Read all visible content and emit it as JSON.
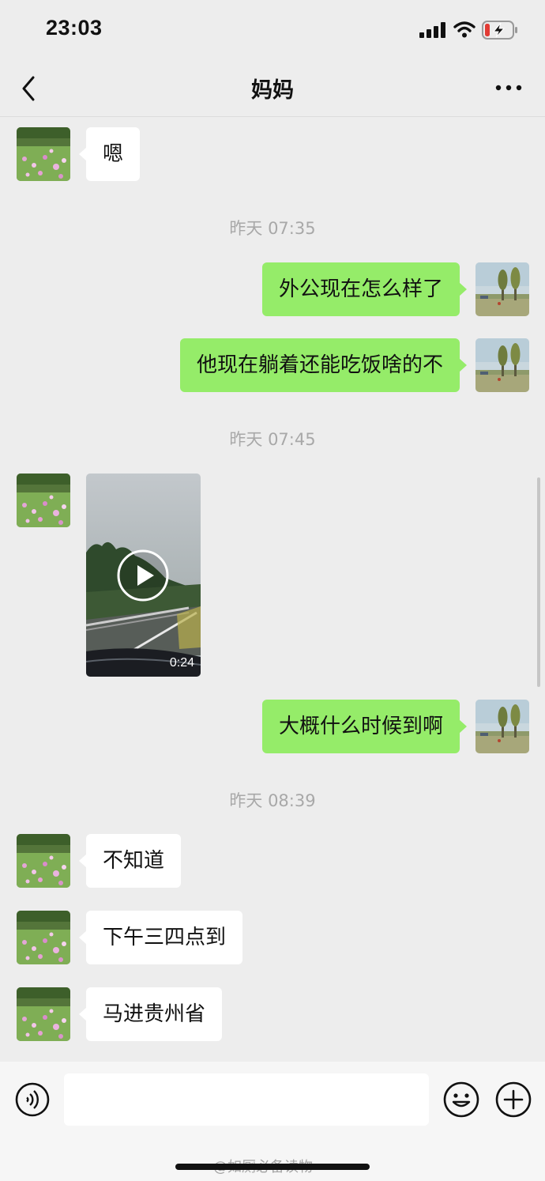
{
  "status_bar": {
    "time": "23:03"
  },
  "nav": {
    "title": "妈妈"
  },
  "messages": [
    {
      "side": "in",
      "text": "嗯"
    },
    {
      "timestamp": "昨天 07:35"
    },
    {
      "side": "out",
      "text": "外公现在怎么样了"
    },
    {
      "side": "out",
      "text": "他现在躺着还能吃饭啥的不"
    },
    {
      "timestamp": "昨天 07:45"
    },
    {
      "side": "in",
      "type": "video",
      "duration": "0:24"
    },
    {
      "side": "out",
      "text": "大概什么时候到啊"
    },
    {
      "timestamp": "昨天 08:39"
    },
    {
      "side": "in",
      "text": "不知道"
    },
    {
      "side": "in",
      "text": "下午三四点到"
    },
    {
      "side": "in",
      "text": "马进贵州省"
    }
  ],
  "input": {
    "placeholder": ""
  },
  "watermark": "@如厕必备读物",
  "colors": {
    "outgoing_bubble": "#95ec69",
    "incoming_bubble": "#ffffff",
    "background": "#ededed"
  },
  "icons": [
    "back-icon",
    "more-icon",
    "voice-icon",
    "emoji-icon",
    "plus-icon",
    "play-icon"
  ]
}
